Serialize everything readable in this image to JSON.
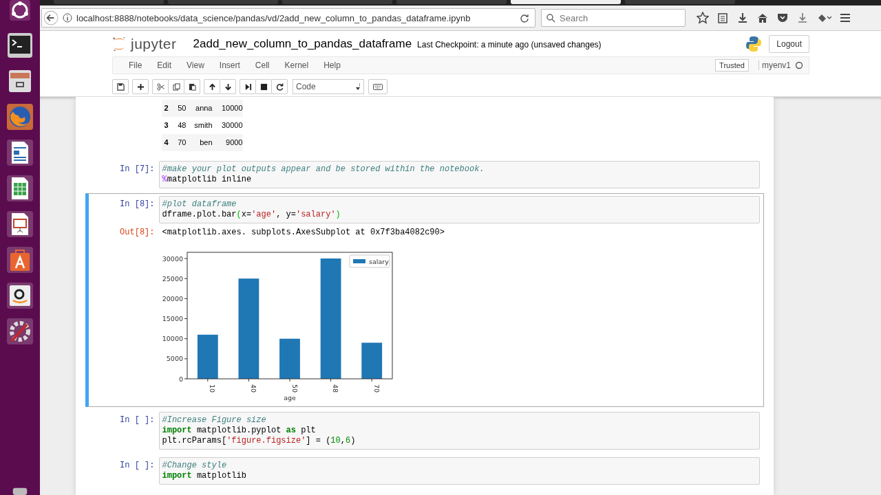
{
  "browser_tabs": [
    {
      "selected": false
    },
    {
      "selected": false
    },
    {
      "selected": false
    },
    {
      "selected": false
    },
    {
      "selected": true
    },
    {
      "selected": false
    }
  ],
  "browser": {
    "url": "localhost:8888/notebooks/data_science/pandas/vd/2add_new_column_to_pandas_dataframe.ipynb",
    "search": {
      "placeholder": "Search"
    }
  },
  "header": {
    "logo": "jupyter",
    "title": "2add_new_column_to_pandas_dataframe",
    "checkpoint": "Last Checkpoint: a minute ago (unsaved changes)",
    "logout": "Logout"
  },
  "menu": [
    "File",
    "Edit",
    "View",
    "Insert",
    "Cell",
    "Kernel",
    "Help"
  ],
  "trusted": "Trusted",
  "kernel": "myenv1",
  "cell_type": "Code",
  "table_rows": [
    [
      "2",
      "50",
      "anna",
      "10000"
    ],
    [
      "3",
      "48",
      "smith",
      "30000"
    ],
    [
      "4",
      "70",
      "ben",
      "9000"
    ]
  ],
  "cells": [
    {
      "prompt": "In [7]:",
      "selected": false,
      "lines": [
        [
          {
            "kind": "comment",
            "text": "#make your plot outputs appear and be stored within the notebook."
          }
        ],
        [
          {
            "kind": "magic",
            "text": "%"
          },
          {
            "kind": "plain",
            "text": "matplotlib inline"
          }
        ]
      ]
    },
    {
      "prompt": "In [8]:",
      "selected": true,
      "lines": [
        [
          {
            "kind": "comment",
            "text": "#plot dataframe"
          }
        ],
        [
          {
            "kind": "plain",
            "text": "dframe.plot.bar"
          },
          {
            "kind": "bracket",
            "text": "("
          },
          {
            "kind": "plain",
            "text": "x="
          },
          {
            "kind": "string",
            "text": "'age'"
          },
          {
            "kind": "plain",
            "text": ", y="
          },
          {
            "kind": "string",
            "text": "'salary'"
          },
          {
            "kind": "bracket",
            "text": ")"
          }
        ]
      ],
      "output_prompt": "Out[8]:",
      "output_text": "<matplotlib.axes. subplots.AxesSubplot at 0x7f3ba4082c90>",
      "chart_data": {
        "type": "bar",
        "xlabel": "age",
        "categories": [
          "10",
          "40",
          "50",
          "48",
          "70"
        ],
        "series": [
          {
            "name": "salary",
            "color": "#1f77b4",
            "values": [
              11000,
              25000,
              10000,
              30000,
              9000
            ]
          }
        ],
        "ylim": [
          0,
          30000
        ],
        "yticks": [
          0,
          5000,
          10000,
          15000,
          20000,
          25000,
          30000
        ]
      }
    },
    {
      "prompt": "In [ ]:",
      "selected": false,
      "lines": [
        [
          {
            "kind": "comment",
            "text": "#Increase Figure size"
          }
        ],
        [
          {
            "kind": "keyword",
            "text": "import"
          },
          {
            "kind": "plain",
            "text": " matplotlib.pyplot "
          },
          {
            "kind": "keyword",
            "text": "as"
          },
          {
            "kind": "plain",
            "text": " plt"
          }
        ],
        [
          {
            "kind": "plain",
            "text": "plt.rcParams["
          },
          {
            "kind": "string",
            "text": "'figure.figsize'"
          },
          {
            "kind": "plain",
            "text": "] = ("
          },
          {
            "kind": "number",
            "text": "10"
          },
          {
            "kind": "plain",
            "text": ","
          },
          {
            "kind": "number",
            "text": "6"
          },
          {
            "kind": "plain",
            "text": ")"
          }
        ]
      ]
    },
    {
      "prompt": "In [ ]:",
      "selected": false,
      "lines": [
        [
          {
            "kind": "comment",
            "text": "#Change style"
          }
        ],
        [
          {
            "kind": "keyword",
            "text": "import"
          },
          {
            "kind": "plain",
            "text": " matplotlib"
          }
        ]
      ]
    }
  ]
}
